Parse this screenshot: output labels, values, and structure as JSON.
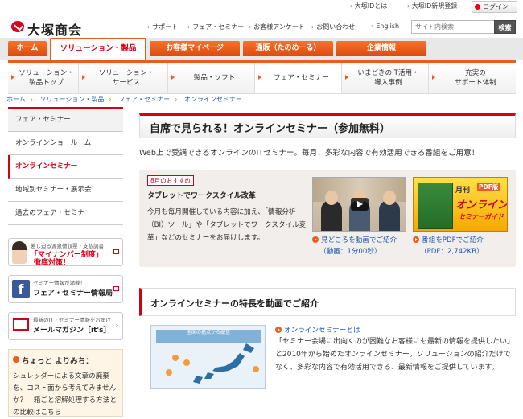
{
  "topbar": {
    "otsuka_id": "大塚IDとは",
    "register": "大塚ID新規登録",
    "login": "ログイン"
  },
  "logo": {
    "text": "大塚商会"
  },
  "util": {
    "support": "サポート",
    "fair": "フェア・セミナー",
    "survey": "お客様アンケート",
    "inquiry": "お問い合わせ",
    "english": "English",
    "search_placeholder": "サイト内検索",
    "search_button": "検索"
  },
  "gnav": {
    "home": "ホーム",
    "solutions": "ソリューション・製品",
    "mypage": "お客様マイページ",
    "tanomeru": "通販（たのめーる）",
    "corporate": "企業情報"
  },
  "subnav": [
    {
      "l1": "ソリューション・",
      "l2": "製品トップ"
    },
    {
      "l1": "ソリューション・",
      "l2": "サービス"
    },
    {
      "l1": "製品・ソフト",
      "l2": ""
    },
    {
      "l1": "フェア・セミナー",
      "l2": ""
    },
    {
      "l1": "いまどきのIT活用・",
      "l2": "導入事例"
    },
    {
      "l1": "充実の",
      "l2": "サポート体制"
    }
  ],
  "breadcrumb": [
    "ホーム",
    "ソリューション・製品",
    "フェア・セミナー",
    "オンラインセミナー"
  ],
  "sidemenu": [
    "フェア・セミナー",
    "オンラインショールーム",
    "オンラインセミナー",
    "地域別セミナー・展示会",
    "過去のフェア・セミナー"
  ],
  "banners": {
    "mynumber_small": "差し迫る源泉徴収票・支払調書",
    "mynumber_big1": "「マイナンバー制度」",
    "mynumber_big2": "徹底対策！",
    "facebook_small": "セミナー情報が満載！",
    "facebook_big": "フェア・セミナー情報局",
    "mail_small": "最新のIT・セミナー情報をお届け",
    "mail_big": "メールマガジン［it's］"
  },
  "chotto": {
    "head": "ちょっと よりみち：",
    "body": "シュレッダーによる文章の廃棄を、コスト面から考えてみませんか？　箱ごと溶解処理する方法との比較はこちら"
  },
  "page": {
    "title": "自席で見られる！オンラインセミナー（参加無料）",
    "intro": "Web上で受講できるオンラインのITセミナー。毎月、多彩な内容で有効活用できる番組をご用意！"
  },
  "feature": {
    "badge": "8月のおすすめ",
    "title": "タブレットでワークスタイル改革",
    "body": "今月も毎月開催している内容に加え、「情報分析（BI）ツール」や「タブレットでワークスタイル変革」などのセミナーをお届けします。",
    "video_link": "見どころを動画でご紹介",
    "video_sub": "（動画：1分00秒）",
    "pdf_link": "番組をPDFでご紹介",
    "pdf_sub": "（PDF：2,742KB）",
    "pdf_cover_1": "月刊",
    "pdf_cover_tag": "PDF版",
    "pdf_cover_2": "オンライン",
    "pdf_cover_3": "セミナーガイド"
  },
  "section2": {
    "title": "オンラインセミナーの特長を動画でご紹介",
    "link": "オンラインセミナーとは",
    "body": "「セミナー会場に出向くのが困難なお客様にも最新の情報を提供したい」と2010年から始めたオンラインセミナー。ソリューションの紹介だけでなく、多彩な内容で有効活用できる、最新情報をご提供しています。",
    "map_header": "全国の拠点から配信"
  }
}
